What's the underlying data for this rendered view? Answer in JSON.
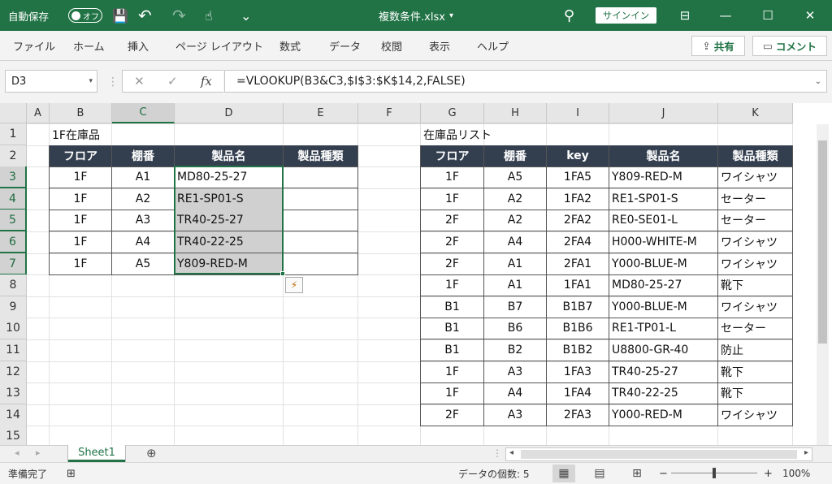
{
  "titlebar": {
    "autosave_label": "自動保存",
    "autosave_state": "オフ",
    "filename": "複数条件.xlsx",
    "filename_arrow": "▾",
    "signin": "サインイン",
    "icons": {
      "save": "💾",
      "undo": "↶",
      "redo": "↷",
      "touch": "☝",
      "customize": "⌄",
      "search": "⚲",
      "ribbon_display": "⊟",
      "minimize": "—",
      "maximize": "☐",
      "close": "✕"
    }
  },
  "ribbon": {
    "tabs": [
      "ファイル",
      "ホーム",
      "挿入",
      "ページ レイアウト",
      "数式",
      "データ",
      "校閲",
      "表示",
      "ヘルプ"
    ],
    "share": "共有",
    "comment": "コメント"
  },
  "formula_bar": {
    "name_box": "D3",
    "cancel": "✕",
    "enter": "✓",
    "fx": "fx",
    "formula": "=VLOOKUP(B3&C3,$I$3:$K$14,2,FALSE)"
  },
  "columns": [
    "A",
    "B",
    "C",
    "D",
    "E",
    "F",
    "G",
    "H",
    "I",
    "J",
    "K"
  ],
  "rows": [
    "1",
    "2",
    "3",
    "4",
    "5",
    "6",
    "7",
    "8",
    "9",
    "10",
    "11",
    "12",
    "13",
    "14",
    "15"
  ],
  "left_table": {
    "caption": "1F在庫品",
    "headers": [
      "フロア",
      "棚番",
      "製品名",
      "製品種類"
    ],
    "rows": [
      [
        "1F",
        "A1",
        "MD80-25-27",
        ""
      ],
      [
        "1F",
        "A2",
        "RE1-SP01-S",
        ""
      ],
      [
        "1F",
        "A3",
        "TR40-25-27",
        ""
      ],
      [
        "1F",
        "A4",
        "TR40-22-25",
        ""
      ],
      [
        "1F",
        "A5",
        "Y809-RED-M",
        ""
      ]
    ]
  },
  "right_table": {
    "caption": "在庫品リスト",
    "headers": [
      "フロア",
      "棚番",
      "key",
      "製品名",
      "製品種類"
    ],
    "rows": [
      [
        "1F",
        "A5",
        "1FA5",
        "Y809-RED-M",
        "ワイシャツ"
      ],
      [
        "1F",
        "A2",
        "1FA2",
        "RE1-SP01-S",
        "セーター"
      ],
      [
        "2F",
        "A2",
        "2FA2",
        "RE0-SE01-L",
        "セーター"
      ],
      [
        "2F",
        "A4",
        "2FA4",
        "H000-WHITE-M",
        "ワイシャツ"
      ],
      [
        "2F",
        "A1",
        "2FA1",
        "Y000-BLUE-M",
        "ワイシャツ"
      ],
      [
        "1F",
        "A1",
        "1FA1",
        "MD80-25-27",
        "靴下"
      ],
      [
        "B1",
        "B7",
        "B1B7",
        "Y000-BLUE-M",
        "ワイシャツ"
      ],
      [
        "B1",
        "B6",
        "B1B6",
        "RE1-TP01-L",
        "セーター"
      ],
      [
        "B1",
        "B2",
        "B1B2",
        "U8800-GR-40",
        "防止"
      ],
      [
        "1F",
        "A3",
        "1FA3",
        "TR40-25-27",
        "靴下"
      ],
      [
        "1F",
        "A4",
        "1FA4",
        "TR40-22-25",
        "靴下"
      ],
      [
        "2F",
        "A3",
        "2FA3",
        "Y000-RED-M",
        "ワイシャツ"
      ]
    ]
  },
  "sheets": [
    "Sheet1"
  ],
  "add_sheet": "⊕",
  "statusbar": {
    "ready": "準備完了",
    "count_label": "データの個数: 5",
    "zoom_minus": "−",
    "zoom_plus": "+",
    "zoom": "100%"
  },
  "colors": {
    "excel_green": "#217346",
    "table_header": "#333f4f",
    "shaded": "#d0d0d0"
  }
}
